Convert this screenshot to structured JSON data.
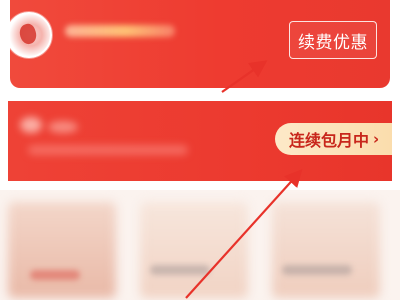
{
  "top_banner": {
    "renew_button_label": "续费优惠"
  },
  "mid_banner": {
    "subscription_label": "连续包月中",
    "subscription_chevron": "›"
  },
  "colors": {
    "banner_red": "#ee3b30",
    "pill_bg": "#fbdcab",
    "pill_text": "#c8261b",
    "arrow_red": "#e8322a"
  },
  "icons": {
    "avatar": "avatar-icon",
    "chevron": "chevron-right-icon",
    "arrows": "annotation-arrow"
  }
}
